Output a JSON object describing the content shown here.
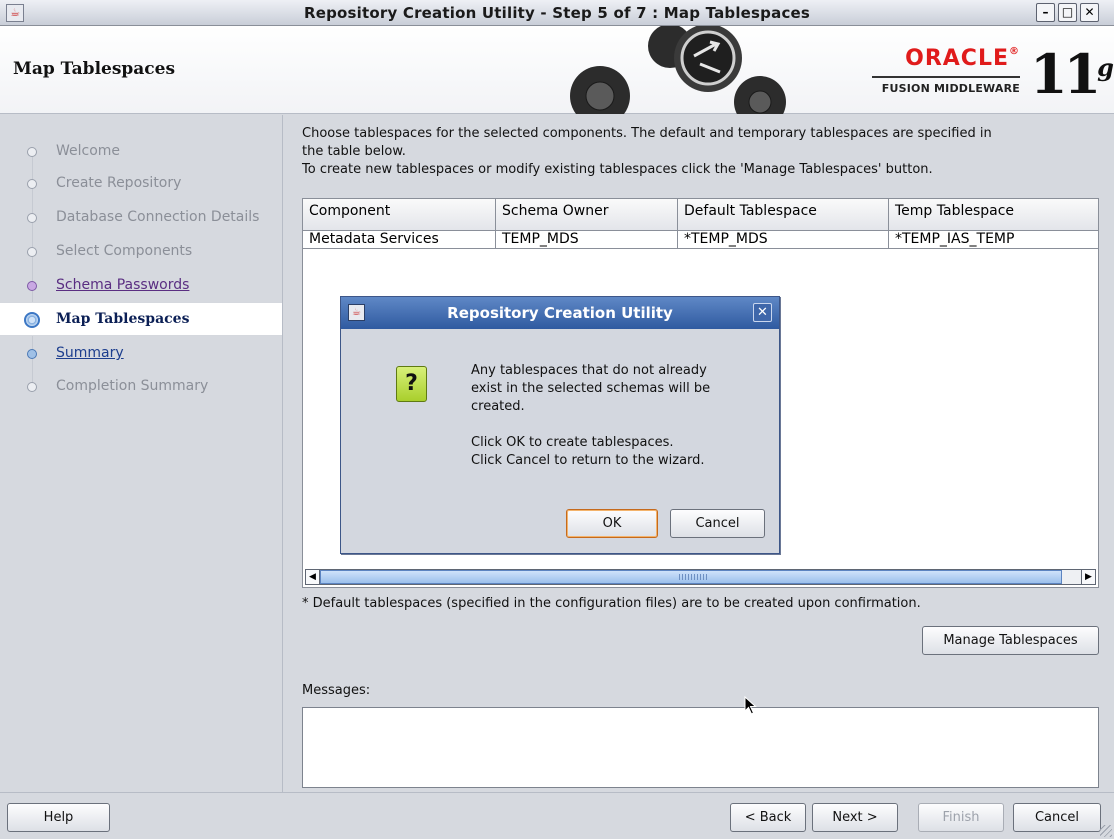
{
  "window": {
    "title": "Repository Creation Utility - Step 5 of 7 : Map Tablespaces",
    "app_icon": "java-cup-icon",
    "controls": [
      "minimize-icon",
      "maximize-icon",
      "close-icon"
    ]
  },
  "header": {
    "page_title": "Map Tablespaces",
    "brand": "ORACLE",
    "brand_registered": "®",
    "product": "FUSION MIDDLEWARE",
    "version": "11",
    "version_suffix": "g",
    "brand_color": "#e01b1b"
  },
  "nav": {
    "items": [
      {
        "label": "Welcome",
        "state": "disabled"
      },
      {
        "label": "Create Repository",
        "state": "disabled"
      },
      {
        "label": "Database Connection Details",
        "state": "disabled"
      },
      {
        "label": "Select Components",
        "state": "disabled"
      },
      {
        "label": "Schema Passwords",
        "state": "visited"
      },
      {
        "label": "Map Tablespaces",
        "state": "current"
      },
      {
        "label": "Summary",
        "state": "link"
      },
      {
        "label": "Completion Summary",
        "state": "disabled"
      }
    ]
  },
  "main": {
    "intro_line1": "Choose tablespaces for the selected components. The default and temporary tablespaces are specified in",
    "intro_line2": "the table below.",
    "intro_line3": "To create new tablespaces or modify existing tablespaces click the 'Manage Tablespaces' button.",
    "table": {
      "columns": [
        "Component",
        "Schema Owner",
        "Default Tablespace",
        "Temp Tablespace"
      ],
      "rows": [
        [
          "Metadata Services",
          "TEMP_MDS",
          "*TEMP_MDS",
          "*TEMP_IAS_TEMP"
        ]
      ]
    },
    "footnote": "* Default tablespaces (specified in the configuration files) are to be created upon confirmation.",
    "manage_button": "Manage Tablespaces",
    "messages_label": "Messages:",
    "messages_value": ""
  },
  "footer": {
    "help": "Help",
    "back": "< Back",
    "next": "Next >",
    "finish": "Finish",
    "cancel": "Cancel"
  },
  "dialog": {
    "title": "Repository Creation Utility",
    "icon": "question-icon",
    "icon_glyph": "?",
    "line1": "Any tablespaces that do not already",
    "line2": "exist in the selected schemas will be",
    "line3": "created.",
    "line4": "Click OK to create tablespaces.",
    "line5": "Click Cancel to return to the wizard.",
    "ok": "OK",
    "cancel": "Cancel"
  }
}
